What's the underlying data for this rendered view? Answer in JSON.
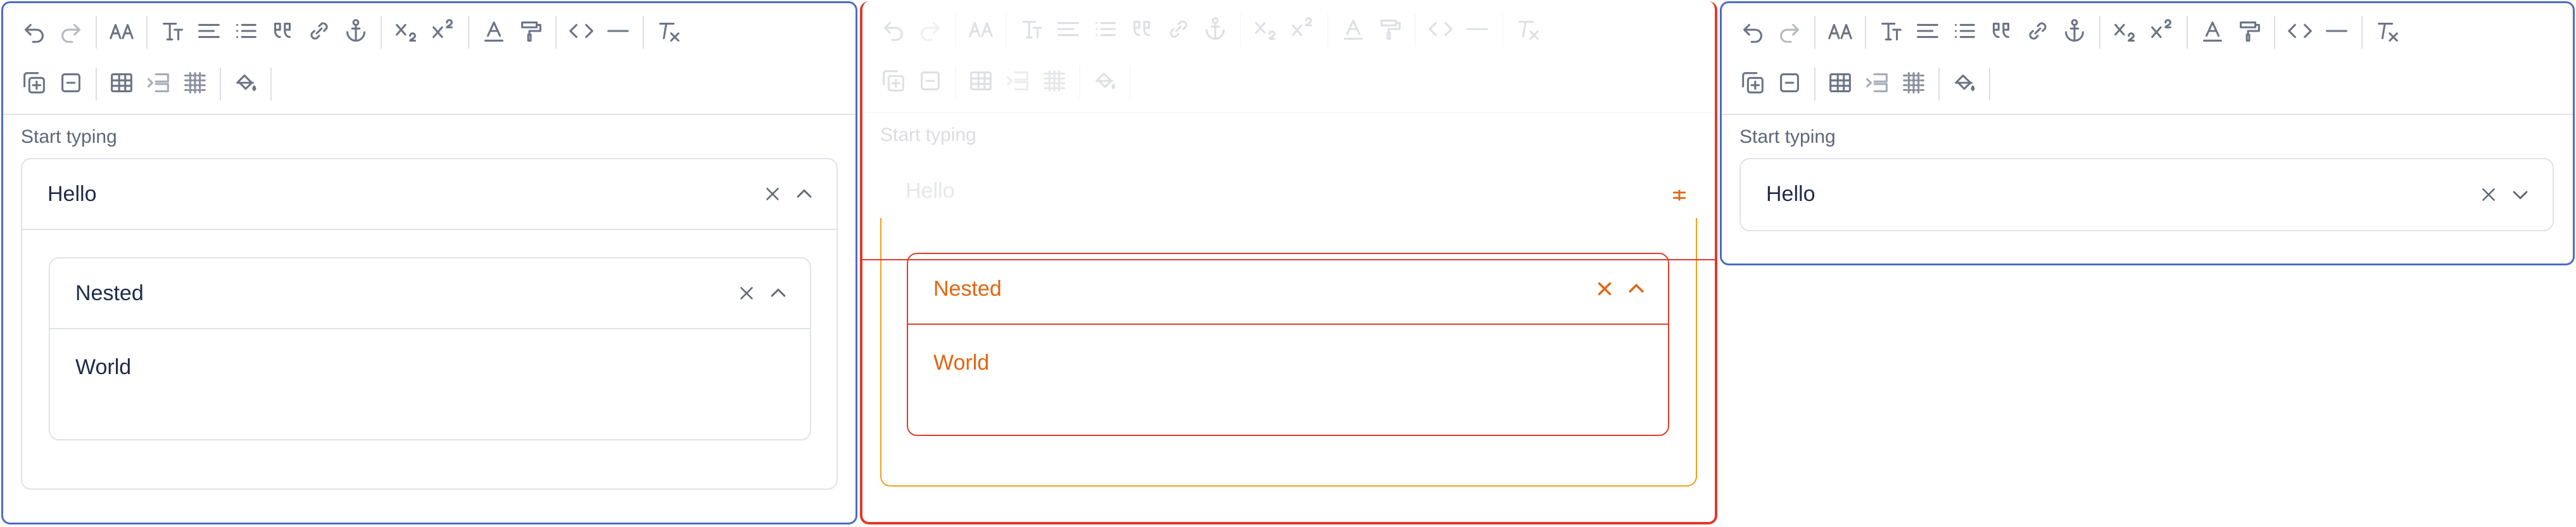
{
  "toolbar": {
    "row1": [
      "undo-icon",
      "redo-icon",
      "|",
      "font-size-icon",
      "|",
      "heading-icon",
      "align-icon",
      "bullet-list-icon",
      "quote-icon",
      "link-icon",
      "anchor-icon",
      "|",
      "subscript-icon",
      "superscript-icon",
      "|",
      "text-color-icon",
      "highlight-icon",
      "|",
      "code-icon",
      "horizontal-rule-icon",
      "|",
      "clear-format-icon"
    ],
    "row2": [
      "add-block-icon",
      "remove-block-icon",
      "|",
      "table-icon",
      "insert-row-icon",
      "table-grid-icon",
      "|",
      "fill-color-icon",
      "|"
    ]
  },
  "colors": {
    "panel_border": "#4f6bc8",
    "ghost_border": "#e03a2c",
    "ghost_text": "#e2650f",
    "text": "#1d2a4a"
  },
  "editor_left": {
    "label": "Start typing",
    "outer_value": "Hello",
    "nested_value": "Nested",
    "nested_body": "World"
  },
  "editor_ghost": {
    "label": "Start typing",
    "outer_value": "Hello",
    "nested_value": "Nested",
    "nested_body": "World"
  },
  "editor_right": {
    "label": "Start typing",
    "outer_value": "Hello"
  }
}
